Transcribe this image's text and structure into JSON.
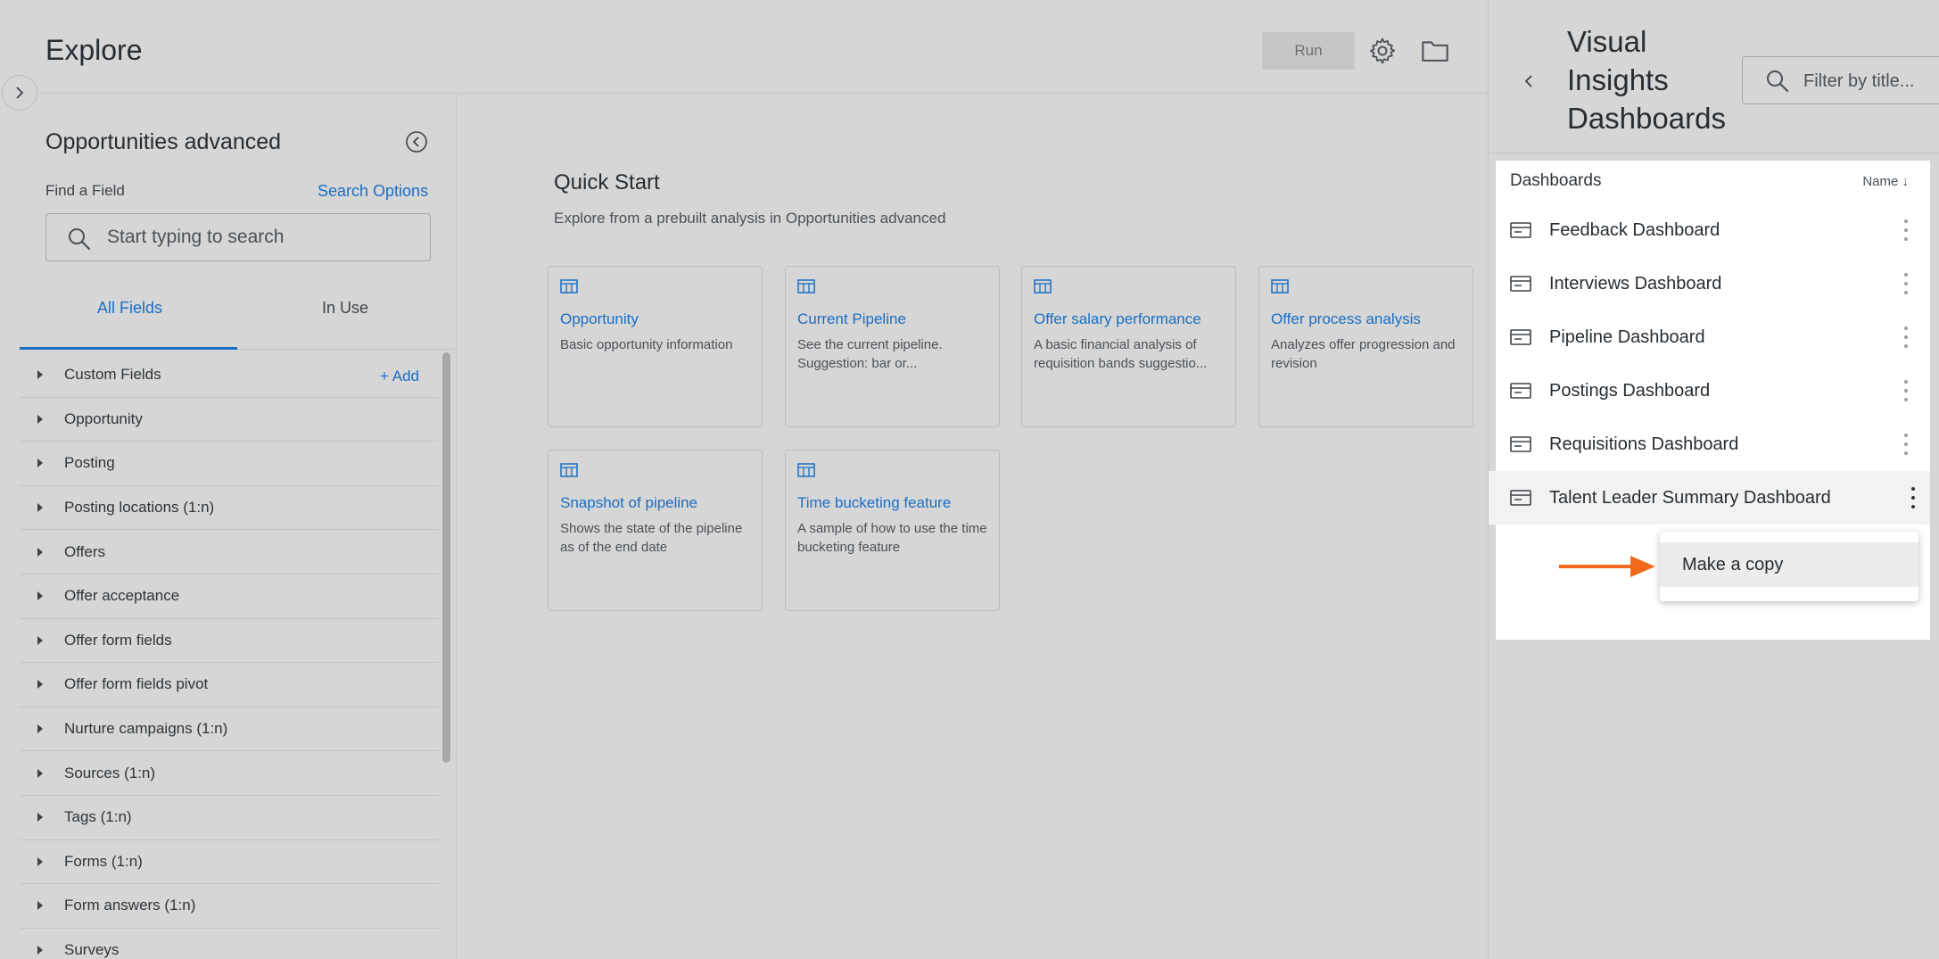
{
  "explore": {
    "title": "Explore",
    "run_label": "Run",
    "icons": {
      "gear": "gear-icon",
      "folder": "folder-icon",
      "expand": "chevron-right-icon"
    }
  },
  "field_picker": {
    "model_name": "Opportunities advanced",
    "find_field_label": "Find a Field",
    "search_options_label": "Search Options",
    "search_placeholder": "Start typing to search",
    "tabs": [
      {
        "label": "All Fields",
        "active": true
      },
      {
        "label": "In Use",
        "active": false
      }
    ],
    "add_label": "+ Add",
    "fields": [
      "Custom Fields",
      "Opportunity",
      "Posting",
      "Posting locations (1:n)",
      "Offers",
      "Offer acceptance",
      "Offer form fields",
      "Offer form fields pivot",
      "Nurture campaigns (1:n)",
      "Sources (1:n)",
      "Tags (1:n)",
      "Forms (1:n)",
      "Form answers (1:n)",
      "Surveys"
    ]
  },
  "quick_start": {
    "title": "Quick Start",
    "subtitle": "Explore from a prebuilt analysis in Opportunities advanced",
    "cards": [
      {
        "title": "Opportunity",
        "description": "Basic opportunity information"
      },
      {
        "title": "Current Pipeline",
        "description": "See the current pipeline. Suggestion: bar or..."
      },
      {
        "title": "Offer salary performance",
        "description": "A basic financial analysis of requisition bands suggestio..."
      },
      {
        "title": "Offer process analysis",
        "description": "Analyzes offer progression and revision"
      },
      {
        "title": "Snapshot of pipeline",
        "description": "Shows the state of the pipeline as of the end date"
      },
      {
        "title": "Time bucketing feature",
        "description": "A sample of how to use the time bucketing feature"
      }
    ]
  },
  "dashboards_panel": {
    "title": "Visual Insights Dashboards",
    "filter_placeholder": "Filter by title...",
    "list_title": "Dashboards",
    "sort_label": "Name ↓",
    "items": [
      "Feedback Dashboard",
      "Interviews Dashboard",
      "Pipeline Dashboard",
      "Postings Dashboard",
      "Requisitions Dashboard",
      "Talent Leader Summary Dashboard"
    ],
    "selected_item": "Talent Leader Summary Dashboard",
    "context_menu": {
      "items": [
        "Make a copy"
      ]
    }
  },
  "colors": {
    "accent": "#1b6ec2",
    "background": "#d6d6d6",
    "annotation_arrow": "#f06a1e"
  }
}
